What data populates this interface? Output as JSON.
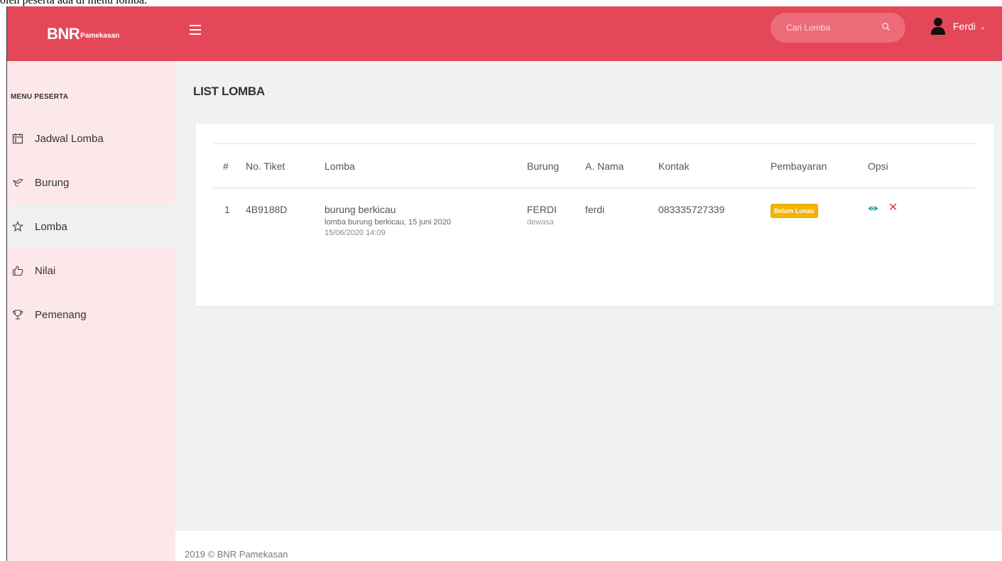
{
  "top_caption": "oleh peserta ada di menu lomba.",
  "header": {
    "brand_main": "BNR",
    "brand_sub": "Pamekasan",
    "search_placeholder": "Cari Lomba",
    "user_name": "Ferdi",
    "accent_color": "#e44858"
  },
  "sidebar": {
    "heading": "MENU PESERTA",
    "items": [
      {
        "label": "Jadwal Lomba",
        "icon": "calendar-icon"
      },
      {
        "label": "Burung",
        "icon": "bird-icon"
      },
      {
        "label": "Lomba",
        "icon": "star-icon",
        "active": true
      },
      {
        "label": "Nilai",
        "icon": "thumbs-up-icon"
      },
      {
        "label": "Pemenang",
        "icon": "trophy-icon"
      }
    ]
  },
  "main": {
    "title": "LIST LOMBA",
    "table": {
      "headers": [
        "#",
        "No. Tiket",
        "Lomba",
        "Burung",
        "A. Nama",
        "Kontak",
        "Pembayaran",
        "Opsi"
      ],
      "rows": [
        {
          "no": "1",
          "tiket": "4B9188D",
          "lomba": "burung berkicau",
          "lomba_desc": "lomba burung berkicau, 15 juni 2020",
          "lomba_date": "15/06/2020 14:09",
          "burung": "FERDI",
          "burung_class": "dewasa",
          "nama": "ferdi",
          "kontak": "083335727339",
          "pembayaran": "Belum Lunas"
        }
      ]
    }
  },
  "footer": {
    "text": "2019 © BNR Pamekasan"
  }
}
